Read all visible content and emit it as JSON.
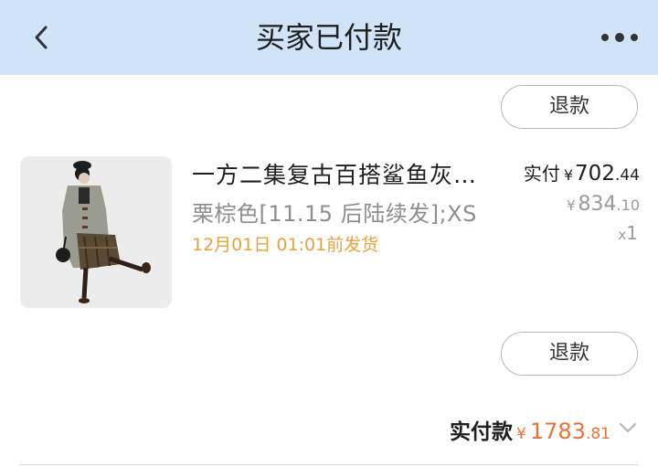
{
  "header": {
    "title": "买家已付款",
    "back_icon": "chevron-left-icon",
    "more_icon": "more-dots-icon",
    "background": "#cfe4f6"
  },
  "refund_buttons": [
    "退款",
    "退款"
  ],
  "product": {
    "name": "一方二集复古百搭鲨鱼灰…",
    "variant": "栗棕色[11.15 后陆续发];XS",
    "shipping_note": "12月01日 01:01前发货",
    "paid_label": "实付",
    "currency": "¥",
    "paid_int": "702",
    "paid_dec": ".44",
    "original_int": "834",
    "original_dec": ".10",
    "qty_prefix": "x",
    "qty": "1"
  },
  "total": {
    "label": "实付款",
    "currency": "¥",
    "int": "1783",
    "dec": ".81",
    "color": "#e8733a"
  },
  "colors": {
    "shipping_note": "#e6a23c",
    "muted": "#9a9a9a"
  }
}
